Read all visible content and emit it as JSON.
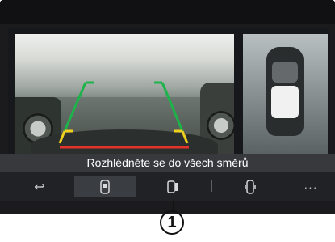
{
  "camera": {
    "guide_colors": {
      "near": "#e2322a",
      "mid": "#f0d11e",
      "far": "#1db24a"
    }
  },
  "status": {
    "message": "Rozhlédněte se do všech směrů"
  },
  "toolbar": {
    "items": [
      {
        "icon": "back-arrow-icon",
        "label": "↩"
      },
      {
        "icon": "camera-view-rear-icon",
        "label": ""
      },
      {
        "icon": "camera-view-side-icon",
        "label": ""
      },
      {
        "icon": "camera-view-360-icon",
        "label": ""
      },
      {
        "icon": "more-icon",
        "label": "···"
      }
    ],
    "active_index": 1
  },
  "callout": {
    "number": "1"
  }
}
